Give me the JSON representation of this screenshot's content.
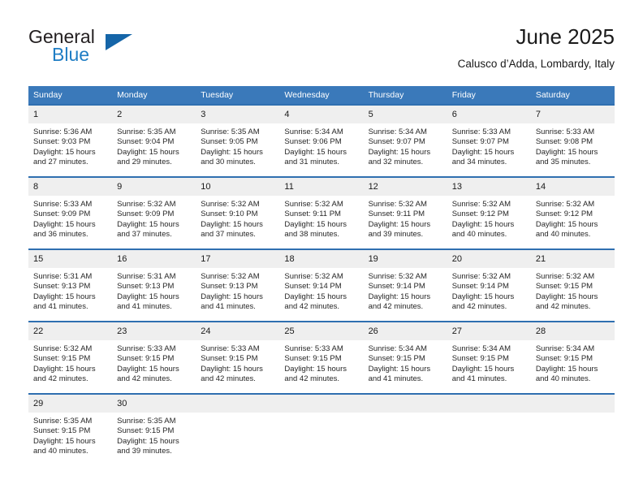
{
  "logo": {
    "word_top": "General",
    "word_bottom": "Blue",
    "triangle_color": "#1565a8",
    "blue_color": "#1f7dc4"
  },
  "header": {
    "title": "June 2025",
    "subtitle": "Calusco d’Adda, Lombardy, Italy"
  },
  "theme": {
    "header_bg": "#3a79ba",
    "row_rule": "#2f6fb0",
    "daynum_bg": "#efefef",
    "text": "#262626"
  },
  "weekday_headers": [
    "Sunday",
    "Monday",
    "Tuesday",
    "Wednesday",
    "Thursday",
    "Friday",
    "Saturday"
  ],
  "weeks": [
    [
      {
        "day": "1",
        "sunrise": "Sunrise: 5:36 AM",
        "sunset": "Sunset: 9:03 PM",
        "daylight": "Daylight: 15 hours and 27 minutes."
      },
      {
        "day": "2",
        "sunrise": "Sunrise: 5:35 AM",
        "sunset": "Sunset: 9:04 PM",
        "daylight": "Daylight: 15 hours and 29 minutes."
      },
      {
        "day": "3",
        "sunrise": "Sunrise: 5:35 AM",
        "sunset": "Sunset: 9:05 PM",
        "daylight": "Daylight: 15 hours and 30 minutes."
      },
      {
        "day": "4",
        "sunrise": "Sunrise: 5:34 AM",
        "sunset": "Sunset: 9:06 PM",
        "daylight": "Daylight: 15 hours and 31 minutes."
      },
      {
        "day": "5",
        "sunrise": "Sunrise: 5:34 AM",
        "sunset": "Sunset: 9:07 PM",
        "daylight": "Daylight: 15 hours and 32 minutes."
      },
      {
        "day": "6",
        "sunrise": "Sunrise: 5:33 AM",
        "sunset": "Sunset: 9:07 PM",
        "daylight": "Daylight: 15 hours and 34 minutes."
      },
      {
        "day": "7",
        "sunrise": "Sunrise: 5:33 AM",
        "sunset": "Sunset: 9:08 PM",
        "daylight": "Daylight: 15 hours and 35 minutes."
      }
    ],
    [
      {
        "day": "8",
        "sunrise": "Sunrise: 5:33 AM",
        "sunset": "Sunset: 9:09 PM",
        "daylight": "Daylight: 15 hours and 36 minutes."
      },
      {
        "day": "9",
        "sunrise": "Sunrise: 5:32 AM",
        "sunset": "Sunset: 9:09 PM",
        "daylight": "Daylight: 15 hours and 37 minutes."
      },
      {
        "day": "10",
        "sunrise": "Sunrise: 5:32 AM",
        "sunset": "Sunset: 9:10 PM",
        "daylight": "Daylight: 15 hours and 37 minutes."
      },
      {
        "day": "11",
        "sunrise": "Sunrise: 5:32 AM",
        "sunset": "Sunset: 9:11 PM",
        "daylight": "Daylight: 15 hours and 38 minutes."
      },
      {
        "day": "12",
        "sunrise": "Sunrise: 5:32 AM",
        "sunset": "Sunset: 9:11 PM",
        "daylight": "Daylight: 15 hours and 39 minutes."
      },
      {
        "day": "13",
        "sunrise": "Sunrise: 5:32 AM",
        "sunset": "Sunset: 9:12 PM",
        "daylight": "Daylight: 15 hours and 40 minutes."
      },
      {
        "day": "14",
        "sunrise": "Sunrise: 5:32 AM",
        "sunset": "Sunset: 9:12 PM",
        "daylight": "Daylight: 15 hours and 40 minutes."
      }
    ],
    [
      {
        "day": "15",
        "sunrise": "Sunrise: 5:31 AM",
        "sunset": "Sunset: 9:13 PM",
        "daylight": "Daylight: 15 hours and 41 minutes."
      },
      {
        "day": "16",
        "sunrise": "Sunrise: 5:31 AM",
        "sunset": "Sunset: 9:13 PM",
        "daylight": "Daylight: 15 hours and 41 minutes."
      },
      {
        "day": "17",
        "sunrise": "Sunrise: 5:32 AM",
        "sunset": "Sunset: 9:13 PM",
        "daylight": "Daylight: 15 hours and 41 minutes."
      },
      {
        "day": "18",
        "sunrise": "Sunrise: 5:32 AM",
        "sunset": "Sunset: 9:14 PM",
        "daylight": "Daylight: 15 hours and 42 minutes."
      },
      {
        "day": "19",
        "sunrise": "Sunrise: 5:32 AM",
        "sunset": "Sunset: 9:14 PM",
        "daylight": "Daylight: 15 hours and 42 minutes."
      },
      {
        "day": "20",
        "sunrise": "Sunrise: 5:32 AM",
        "sunset": "Sunset: 9:14 PM",
        "daylight": "Daylight: 15 hours and 42 minutes."
      },
      {
        "day": "21",
        "sunrise": "Sunrise: 5:32 AM",
        "sunset": "Sunset: 9:15 PM",
        "daylight": "Daylight: 15 hours and 42 minutes."
      }
    ],
    [
      {
        "day": "22",
        "sunrise": "Sunrise: 5:32 AM",
        "sunset": "Sunset: 9:15 PM",
        "daylight": "Daylight: 15 hours and 42 minutes."
      },
      {
        "day": "23",
        "sunrise": "Sunrise: 5:33 AM",
        "sunset": "Sunset: 9:15 PM",
        "daylight": "Daylight: 15 hours and 42 minutes."
      },
      {
        "day": "24",
        "sunrise": "Sunrise: 5:33 AM",
        "sunset": "Sunset: 9:15 PM",
        "daylight": "Daylight: 15 hours and 42 minutes."
      },
      {
        "day": "25",
        "sunrise": "Sunrise: 5:33 AM",
        "sunset": "Sunset: 9:15 PM",
        "daylight": "Daylight: 15 hours and 42 minutes."
      },
      {
        "day": "26",
        "sunrise": "Sunrise: 5:34 AM",
        "sunset": "Sunset: 9:15 PM",
        "daylight": "Daylight: 15 hours and 41 minutes."
      },
      {
        "day": "27",
        "sunrise": "Sunrise: 5:34 AM",
        "sunset": "Sunset: 9:15 PM",
        "daylight": "Daylight: 15 hours and 41 minutes."
      },
      {
        "day": "28",
        "sunrise": "Sunrise: 5:34 AM",
        "sunset": "Sunset: 9:15 PM",
        "daylight": "Daylight: 15 hours and 40 minutes."
      }
    ],
    [
      {
        "day": "29",
        "sunrise": "Sunrise: 5:35 AM",
        "sunset": "Sunset: 9:15 PM",
        "daylight": "Daylight: 15 hours and 40 minutes."
      },
      {
        "day": "30",
        "sunrise": "Sunrise: 5:35 AM",
        "sunset": "Sunset: 9:15 PM",
        "daylight": "Daylight: 15 hours and 39 minutes."
      },
      {
        "day": "",
        "sunrise": "",
        "sunset": "",
        "daylight": ""
      },
      {
        "day": "",
        "sunrise": "",
        "sunset": "",
        "daylight": ""
      },
      {
        "day": "",
        "sunrise": "",
        "sunset": "",
        "daylight": ""
      },
      {
        "day": "",
        "sunrise": "",
        "sunset": "",
        "daylight": ""
      },
      {
        "day": "",
        "sunrise": "",
        "sunset": "",
        "daylight": ""
      }
    ]
  ]
}
